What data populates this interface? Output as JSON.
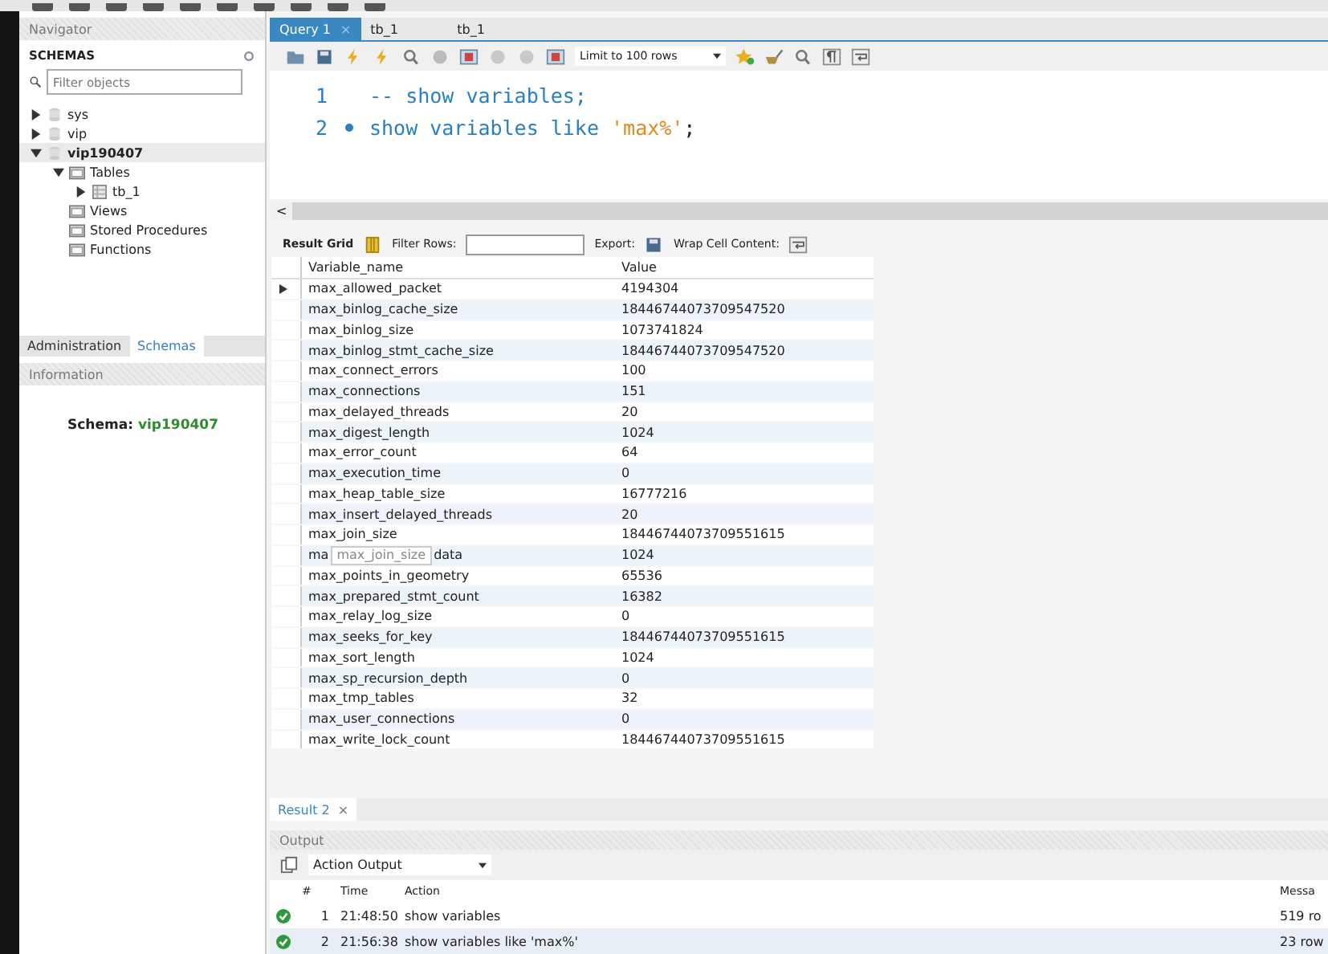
{
  "navigator": {
    "title": "Navigator",
    "schemas_label": "SCHEMAS",
    "filter": {
      "placeholder": "Filter objects"
    },
    "tree": [
      {
        "label": "sys",
        "kind": "schema",
        "expanded": false,
        "selected": false
      },
      {
        "label": "vip",
        "kind": "schema",
        "expanded": false,
        "selected": false
      },
      {
        "label": "vip190407",
        "kind": "schema",
        "expanded": true,
        "selected": true,
        "children": [
          {
            "label": "Tables",
            "kind": "folder",
            "expanded": true,
            "selected": false,
            "children": [
              {
                "label": "tb_1",
                "kind": "table",
                "expanded": false,
                "selected": false
              }
            ]
          },
          {
            "label": "Views",
            "kind": "folder",
            "selected": false
          },
          {
            "label": "Stored Procedures",
            "kind": "folder",
            "selected": false
          },
          {
            "label": "Functions",
            "kind": "folder",
            "selected": false
          }
        ]
      }
    ],
    "tabs": [
      {
        "label": "Administration",
        "selected": false
      },
      {
        "label": "Schemas",
        "selected": true
      }
    ],
    "information": {
      "title": "Information",
      "schema_label": "Schema:",
      "schema_value": "vip190407"
    }
  },
  "editor_tabs": [
    {
      "label": "Query 1",
      "selected": true,
      "close": "×"
    },
    {
      "label": "tb_1",
      "selected": false
    },
    {
      "label": "tb_1",
      "selected": false
    }
  ],
  "toolbar": {
    "limit": "Limit to 100 rows"
  },
  "editor": {
    "lines": [
      {
        "number": "1",
        "executable": false,
        "tokens": [
          {
            "text": "-- show variables;",
            "kind": "keyword"
          }
        ]
      },
      {
        "number": "2",
        "executable": true,
        "tokens": [
          {
            "text": "show variables like ",
            "kind": "keyword"
          },
          {
            "text": "'max%'",
            "kind": "string"
          },
          {
            "text": ";",
            "kind": "punct"
          }
        ]
      }
    ],
    "scroll_left": "<"
  },
  "result_toolbar": {
    "grid_label": "Result Grid",
    "filter_label": "Filter Rows:",
    "export_label": "Export:",
    "wrap_label": "Wrap Cell Content:"
  },
  "grid": {
    "columns": [
      "Variable_name",
      "Value"
    ],
    "rows": [
      {
        "name": "max_allowed_packet",
        "value": "4194304",
        "selected": true
      },
      {
        "name": "max_binlog_cache_size",
        "value": "18446744073709547520",
        "selected": false
      },
      {
        "name": "max_binlog_size",
        "value": "1073741824",
        "selected": false
      },
      {
        "name": "max_binlog_stmt_cache_size",
        "value": "18446744073709547520",
        "selected": false
      },
      {
        "name": "max_connect_errors",
        "value": "100",
        "selected": false
      },
      {
        "name": "max_connections",
        "value": "151",
        "selected": false
      },
      {
        "name": "max_delayed_threads",
        "value": "20",
        "selected": false
      },
      {
        "name": "max_digest_length",
        "value": "1024",
        "selected": false
      },
      {
        "name": "max_error_count",
        "value": "64",
        "selected": false
      },
      {
        "name": "max_execution_time",
        "value": "0",
        "selected": false
      },
      {
        "name": "max_heap_table_size",
        "value": "16777216",
        "selected": false
      },
      {
        "name": "max_insert_delayed_threads",
        "value": "20",
        "selected": false
      },
      {
        "name": "max_join_size",
        "value": "18446744073709551615",
        "selected": false
      },
      {
        "name": "ma",
        "name_end": "data",
        "tooltip": "max_join_size",
        "value": "1024",
        "selected": false
      },
      {
        "name": "max_points_in_geometry",
        "value": "65536",
        "selected": false
      },
      {
        "name": "max_prepared_stmt_count",
        "value": "16382",
        "selected": false
      },
      {
        "name": "max_relay_log_size",
        "value": "0",
        "selected": false
      },
      {
        "name": "max_seeks_for_key",
        "value": "18446744073709551615",
        "selected": false
      },
      {
        "name": "max_sort_length",
        "value": "1024",
        "selected": false
      },
      {
        "name": "max_sp_recursion_depth",
        "value": "0",
        "selected": false
      },
      {
        "name": "max_tmp_tables",
        "value": "32",
        "selected": false
      },
      {
        "name": "max_user_connections",
        "value": "0",
        "selected": false
      },
      {
        "name": "max_write_lock_count",
        "value": "18446744073709551615",
        "selected": false
      }
    ]
  },
  "result_tabs": [
    {
      "label": "Result 2",
      "selected": true,
      "close": "×"
    }
  ],
  "output": {
    "title": "Output",
    "selector": "Action Output",
    "columns": [
      "#",
      "Time",
      "Action",
      "Messa"
    ],
    "rows": [
      {
        "succeeded": true,
        "number": "1",
        "time": "21:48:50",
        "action": "show variables",
        "message": "519 ro",
        "selected": false
      },
      {
        "succeeded": true,
        "number": "2",
        "time": "21:56:38",
        "action": "show variables like 'max%'",
        "message": "23 row",
        "selected": true
      }
    ]
  }
}
